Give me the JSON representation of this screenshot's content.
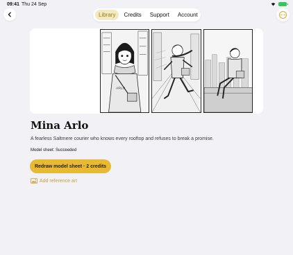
{
  "status_bar": {
    "time": "09:41",
    "date": "Thu 24 Sep"
  },
  "nav": {
    "tabs": [
      {
        "label": "Library",
        "active": true
      },
      {
        "label": "Credits",
        "active": false
      },
      {
        "label": "Support",
        "active": false
      },
      {
        "label": "Account",
        "active": false
      }
    ]
  },
  "character": {
    "name": "Mina Arlo",
    "description": "A fearless Saltmere courier who knows every rooftop and refuses to break a promise.",
    "model_sheet_status": "Model sheet: Succeeded",
    "hero_image": "three-panel-manga-model-sheet"
  },
  "actions": {
    "redraw_label": "Redraw model sheet · 2 credits",
    "add_reference_label": "Add reference art"
  },
  "colors": {
    "accent": "#e8b932",
    "accent_text": "#c9a13a",
    "active_tab_bg": "#f3e9c3",
    "background": "#f2f1f6",
    "battery": "#34c759"
  },
  "icons": {
    "back": "chevron-left-icon",
    "menu": "more-circle-icon",
    "reference": "image-icon",
    "wifi": "wifi-icon",
    "battery": "battery-icon"
  }
}
